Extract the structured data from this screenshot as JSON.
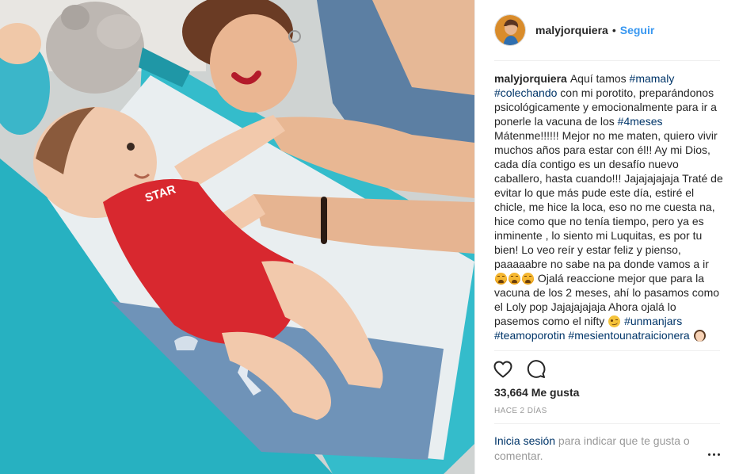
{
  "post": {
    "username": "malyjorquiera",
    "separator": "•",
    "follow_label": "Seguir",
    "caption": [
      {
        "type": "user",
        "text": "malyjorquiera"
      },
      {
        "type": "text",
        "text": "Aquí tamos "
      },
      {
        "type": "tag",
        "text": "#mamaly"
      },
      {
        "type": "text",
        "text": " "
      },
      {
        "type": "tag",
        "text": "#colechando"
      },
      {
        "type": "text",
        "text": " con mi porotito, preparándonos psicológicamente y emocionalmente para ir a ponerle la vacuna de los "
      },
      {
        "type": "tag",
        "text": "#4meses"
      },
      {
        "type": "text",
        "text": " Mátenme!!!!!! Mejor no me maten, quiero vivir muchos años para estar con él!! Ay mi Dios, cada día contigo es un desafío nuevo caballero, hasta cuando!!! Jajajajajaja Traté de evitar lo que más pude este día, estiré el chicle, me hice la loca, eso no me cuesta na, hice como que no tenía tiempo, pero ya es inminente , lo siento mi Luquitas, es por tu bien! Lo veo reír y estar feliz y pienso, paaaaabre no sabe na pa donde vamos a ir "
      },
      {
        "type": "emoji",
        "text": "tired-face"
      },
      {
        "type": "emoji",
        "text": "tired-face"
      },
      {
        "type": "emoji",
        "text": "tired-face"
      },
      {
        "type": "text",
        "text": "  Ojalá reaccione mejor que para la vacuna de los 2 meses, ahí lo pasamos como el Loly pop Jajajajajaja Ahora ojalá lo pasemos como el nifty "
      },
      {
        "type": "emoji",
        "text": "winking-face"
      },
      {
        "type": "text",
        "text": " "
      },
      {
        "type": "tag",
        "text": "#unmanjars"
      },
      {
        "type": "text",
        "text": " "
      },
      {
        "type": "tag",
        "text": "#teamoporotin"
      },
      {
        "type": "text",
        "text": " "
      },
      {
        "type": "tag",
        "text": "#mesientounatraicionera"
      },
      {
        "type": "text",
        "text": " "
      },
      {
        "type": "emoji",
        "text": "woman"
      }
    ],
    "likes": "33,664 Me gusta",
    "time_ago": "HACE 2 DÍAS",
    "login_link": "Inicia sesión",
    "login_rest": " para indicar que te gusta o comentar.",
    "icons": {
      "like": "heart-icon",
      "comment": "comment-icon",
      "more": "more-options-icon"
    },
    "colors": {
      "link_blue": "#3897f0",
      "hashtag": "#003569",
      "muted": "#999999",
      "crib_teal": "#2bb3c0",
      "onesie_red": "#d8282f"
    }
  }
}
